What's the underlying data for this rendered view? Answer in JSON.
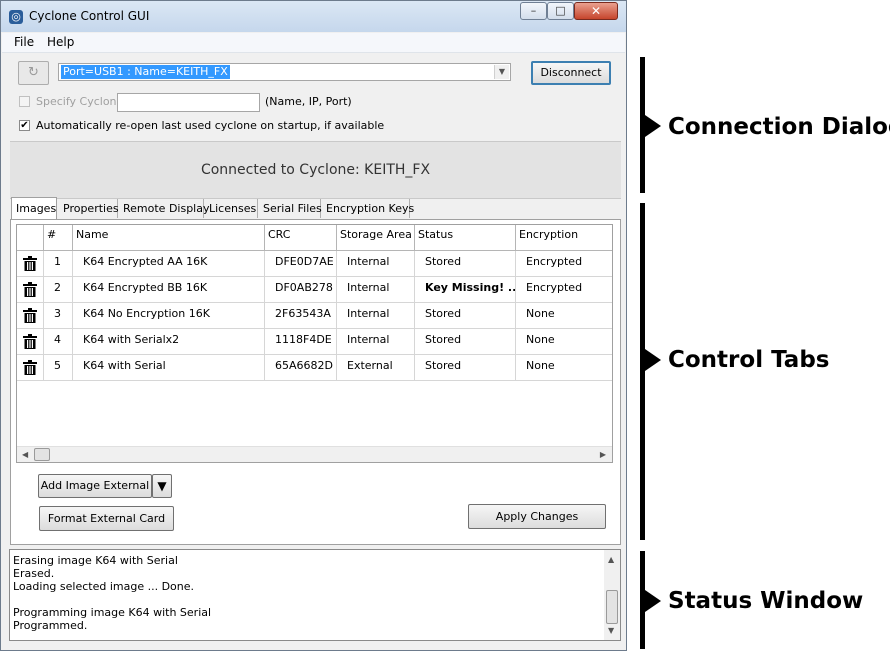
{
  "window": {
    "title": "Cyclone Control GUI",
    "controls": {
      "minimize": "–",
      "maximize": "□",
      "close": "✕"
    }
  },
  "menu": [
    "File",
    "Help"
  ],
  "connection": {
    "refresh_icon": "↻",
    "port_value": "Port=USB1 : Name=KEITH_FX",
    "disconnect_label": "Disconnect",
    "specify_label": "Specify Cyclone",
    "specify_hint": "(Name, IP, Port)",
    "specify_value": "",
    "specify_checked": false,
    "auto_reopen_label": "Automatically re-open last used cyclone on startup, if available",
    "auto_reopen_checked": true,
    "status_text": "Connected to Cyclone: KEITH_FX"
  },
  "tabs": [
    "Images",
    "Properties",
    "Remote Display",
    "Licenses",
    "Serial Files",
    "Encryption Keys"
  ],
  "active_tab": "Images",
  "image_table": {
    "columns": [
      "",
      "#",
      "Name",
      "CRC",
      "Storage Area",
      "Status",
      "Encryption"
    ],
    "rows": [
      {
        "num": "1",
        "name": "K64 Encrypted AA 16K",
        "crc": "DFE0D7AE",
        "storage": "Internal",
        "status": "Stored",
        "encryption": "Encrypted"
      },
      {
        "num": "2",
        "name": "K64 Encrypted BB 16K",
        "crc": "DF0AB278",
        "storage": "Internal",
        "status": "Key Missing! ...",
        "encryption": "Encrypted"
      },
      {
        "num": "3",
        "name": "K64 No Encryption 16K",
        "crc": "2F63543A",
        "storage": "Internal",
        "status": "Stored",
        "encryption": "None"
      },
      {
        "num": "4",
        "name": "K64 with Serialx2",
        "crc": "1118F4DE",
        "storage": "Internal",
        "status": "Stored",
        "encryption": "None"
      },
      {
        "num": "5",
        "name": "K64 with Serial",
        "crc": "65A6682D",
        "storage": "External",
        "status": "Stored",
        "encryption": "None"
      }
    ]
  },
  "buttons": {
    "add_image": "Add Image External",
    "add_image_dropdown": "▼",
    "format_card": "Format External Card",
    "apply_changes": "Apply Changes"
  },
  "status_window": [
    "Erasing image K64 with Serial",
    "Erased.",
    "Loading selected image ... Done.",
    "",
    "Programming image K64 with Serial",
    "Programmed."
  ],
  "annotations": {
    "connection": "Connection Dialog",
    "tabs": "Control Tabs",
    "status": "Status Window"
  },
  "colors": {
    "selection": "#3399ff",
    "accent_border": "#3c7fb1"
  }
}
